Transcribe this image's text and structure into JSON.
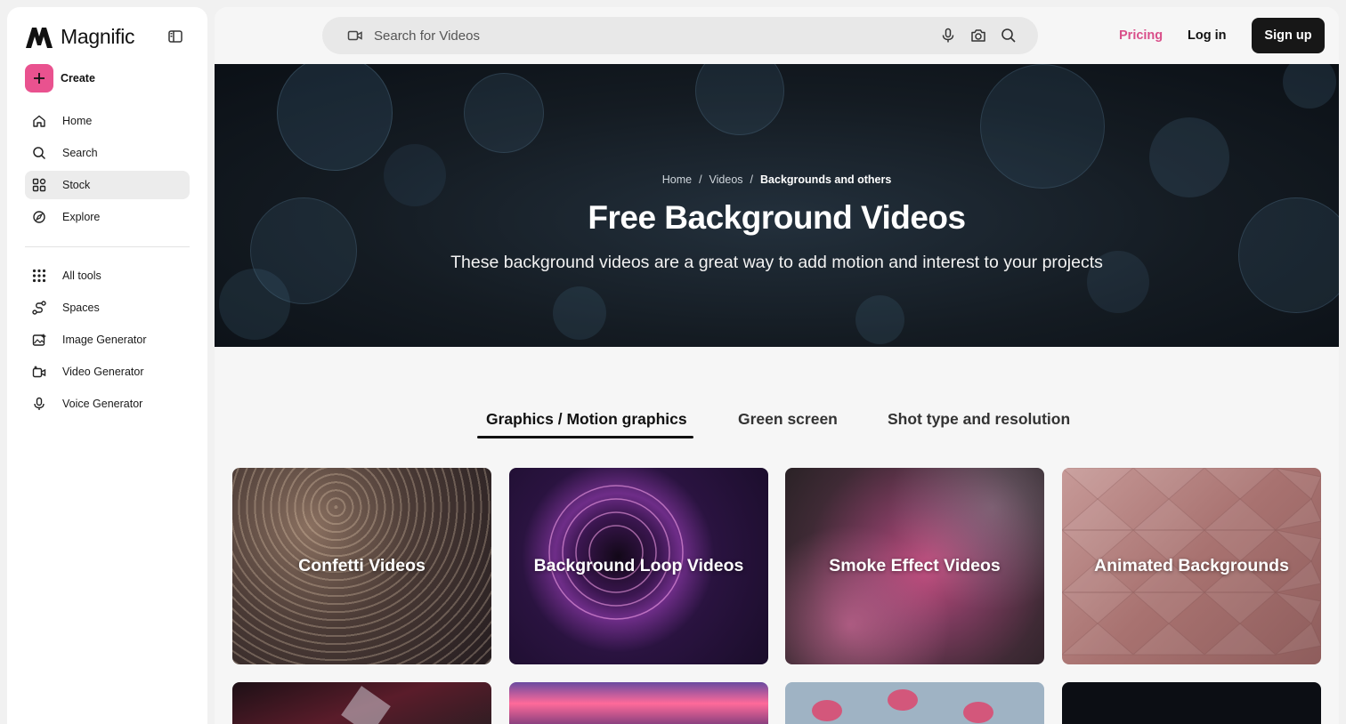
{
  "brand": {
    "name": "Magnific",
    "accent": "#e9528f"
  },
  "sidebar": {
    "create_label": "Create",
    "nav_primary": [
      {
        "label": "Home",
        "icon": "home-icon",
        "active": false
      },
      {
        "label": "Search",
        "icon": "search-icon",
        "active": false
      },
      {
        "label": "Stock",
        "icon": "stock-grid-icon",
        "active": true
      },
      {
        "label": "Explore",
        "icon": "explore-compass-icon",
        "active": false
      }
    ],
    "nav_tools": [
      {
        "label": "All tools",
        "icon": "apps-grid-icon"
      },
      {
        "label": "Spaces",
        "icon": "spaces-icon"
      },
      {
        "label": "Image Generator",
        "icon": "image-generator-icon"
      },
      {
        "label": "Video Generator",
        "icon": "video-generator-icon"
      },
      {
        "label": "Voice Generator",
        "icon": "microphone-icon"
      }
    ]
  },
  "topbar": {
    "search_placeholder": "Search for Videos",
    "pricing": "Pricing",
    "login": "Log in",
    "signup": "Sign up"
  },
  "hero": {
    "breadcrumb": [
      "Home",
      "Videos",
      "Backgrounds and others"
    ],
    "title": "Free Background Videos",
    "subtitle": "These background videos are a great way to add motion and interest to your projects"
  },
  "tabs": [
    {
      "label": "Graphics / Motion graphics",
      "active": true
    },
    {
      "label": "Green screen",
      "active": false
    },
    {
      "label": "Shot type and resolution",
      "active": false
    }
  ],
  "cards": [
    {
      "label": "Confetti Videos"
    },
    {
      "label": "Background Loop Videos"
    },
    {
      "label": "Smoke Effect Videos"
    },
    {
      "label": "Animated Backgrounds"
    }
  ]
}
